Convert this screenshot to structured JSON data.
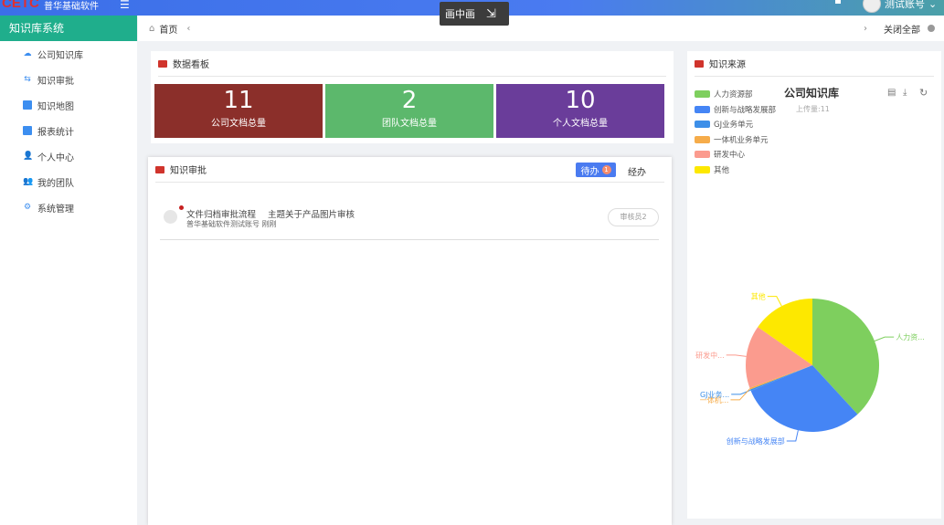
{
  "header": {
    "logo": "CETC",
    "logo_sub": "普华基础软件",
    "user": "测试账号",
    "pip_label": "画中画"
  },
  "sidebar": {
    "title": "知识库系统",
    "items": [
      {
        "label": "公司知识库",
        "icon": "cloud-user-icon"
      },
      {
        "label": "知识审批",
        "icon": "sliders-icon"
      },
      {
        "label": "知识地图",
        "icon": "map-icon"
      },
      {
        "label": "报表统计",
        "icon": "chart-icon"
      },
      {
        "label": "个人中心",
        "icon": "user-card-icon"
      },
      {
        "label": "我的团队",
        "icon": "team-icon"
      },
      {
        "label": "系统管理",
        "icon": "gear-icon"
      }
    ]
  },
  "tabs": {
    "home": "首页",
    "close_all": "关闭全部"
  },
  "dashboard": {
    "title": "数据看板",
    "stats": [
      {
        "value": "11",
        "label": "公司文档总量",
        "color": "#8b2f2a"
      },
      {
        "value": "2",
        "label": "团队文档总量",
        "color": "#5cb86c"
      },
      {
        "value": "10",
        "label": "个人文档总量",
        "color": "#6a3d9a"
      }
    ]
  },
  "approval": {
    "title": "知识审批",
    "tab_todo": "待办",
    "todo_count": "1",
    "tab_done": "经办",
    "items": [
      {
        "title": "文件归档审批流程",
        "subject": "主题关于产品图片审核",
        "meta": "普华基础软件测试账号 刚刚",
        "action": "审核员2"
      }
    ]
  },
  "source": {
    "title": "知识来源",
    "chart_data": {
      "type": "pie",
      "title": "公司知识库",
      "subtitle": "上传量:11",
      "categories": [
        "人力资源部",
        "创新与战略发展部",
        "GJ业务单元",
        "一体机业务单元",
        "研发中心",
        "其他"
      ],
      "labels": [
        "人力资...",
        "创新与战略发展部",
        "GJ业务...",
        "一体机...",
        "研发中...",
        "其他"
      ],
      "values": [
        5,
        4,
        0.05,
        0.05,
        2,
        2
      ],
      "colors": [
        "#7ecf5e",
        "#4585f5",
        "#3d8fe8",
        "#f6ac4a",
        "#fb9b8e",
        "#fde800"
      ],
      "legend": "top-left"
    }
  }
}
